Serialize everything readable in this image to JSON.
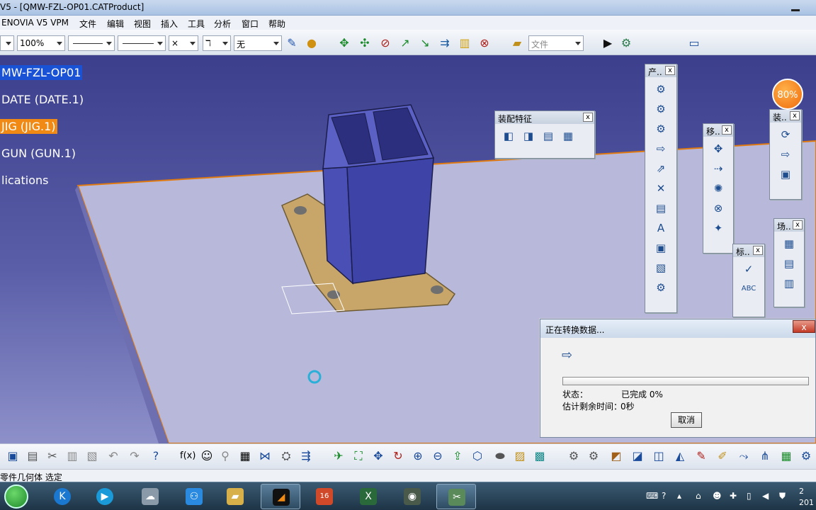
{
  "window": {
    "title": "V5 - [QMW-FZL-OP01.CATProduct]"
  },
  "menu": {
    "items": [
      "ENOVIA V5 VPM",
      "文件",
      "编辑",
      "视图",
      "插入",
      "工具",
      "分析",
      "窗口",
      "帮助"
    ]
  },
  "toolbar": {
    "zoom": "100%",
    "layer": "无",
    "file_combo": "文件",
    "x_label": "×"
  },
  "tree": {
    "items": [
      {
        "label": "MW-FZL-OP01",
        "state": "selected"
      },
      {
        "label": "DATE (DATE.1)",
        "state": "normal"
      },
      {
        "label": "JIG (JIG.1)",
        "state": "highlighted"
      },
      {
        "label": "GUN (GUN.1)",
        "state": "normal"
      },
      {
        "label": "lications",
        "state": "normal"
      }
    ]
  },
  "panels": {
    "assembly_features": {
      "title": "装配特征"
    },
    "product": {
      "title": "产.."
    },
    "move": {
      "title": "移.."
    },
    "assembly": {
      "title": "装.."
    },
    "annotation": {
      "title": "标.."
    },
    "scene": {
      "title": "场.."
    },
    "close_label": "x"
  },
  "badge": {
    "value": "80%"
  },
  "dialog": {
    "title": "正在转换数据...",
    "status_label": "状态：",
    "status_value": "已完成 0%",
    "progress": 0,
    "remaining_label": "估计剩余时间：",
    "remaining_value": "0秒",
    "cancel": "取消",
    "close": "x"
  },
  "statusbar": {
    "text": "零件几何体 选定"
  },
  "taskbar": {
    "clock_top": "2",
    "clock_bottom": "201",
    "badge_count": "16"
  },
  "colors": {
    "viewport_top": "#3c3f8c",
    "plate": "#b8b8da",
    "part_blue": "#3e43a8",
    "flange": "#c8a66a",
    "selection": "#1a52d6",
    "highlight": "#f08a14"
  }
}
